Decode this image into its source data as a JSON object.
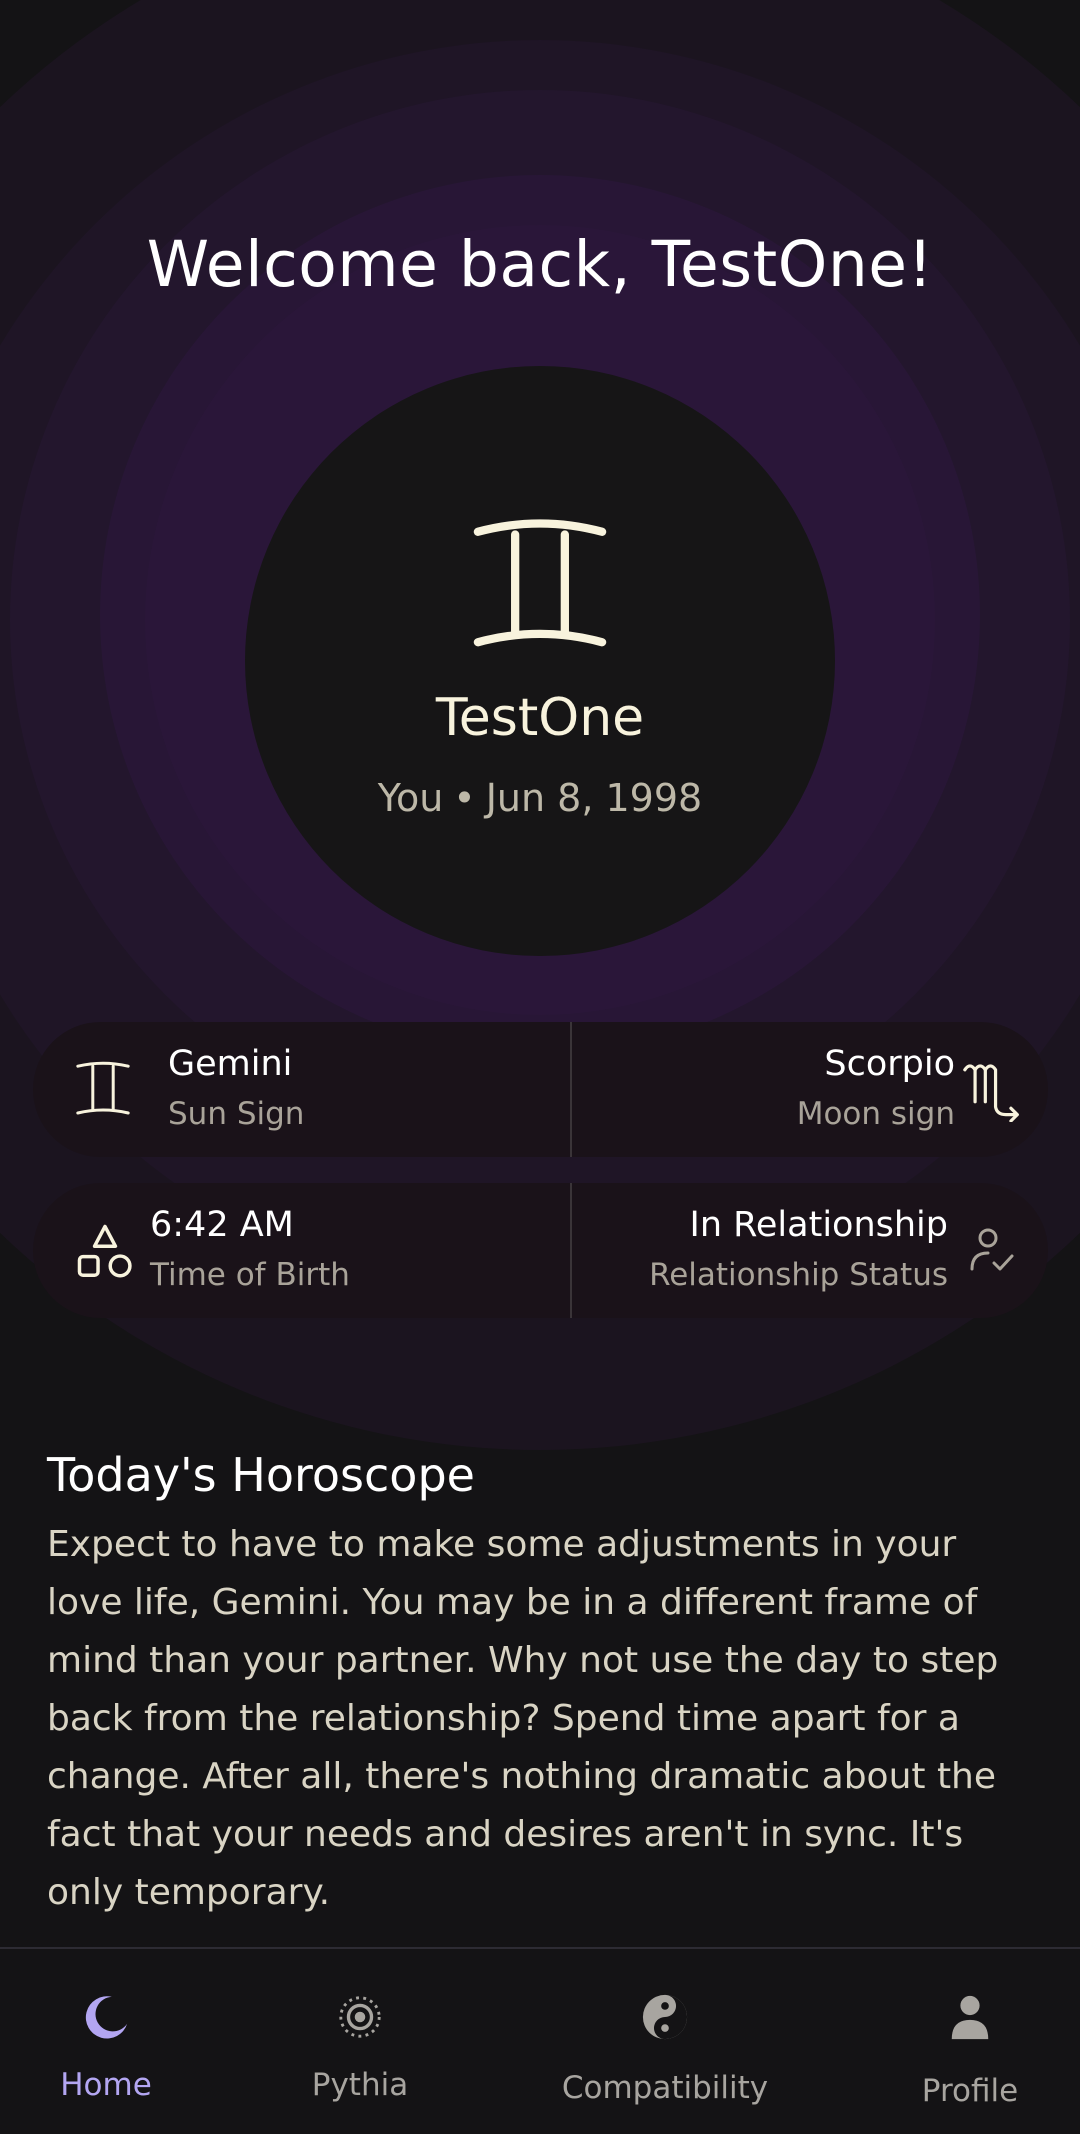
{
  "header": {
    "welcome": "Welcome back, TestOne!"
  },
  "profile": {
    "sign_icon": "gemini-icon",
    "name": "TestOne",
    "relation": "You",
    "separator": "•",
    "birth_date": "Jun 8, 1998"
  },
  "cards": {
    "sun": {
      "title": "Gemini",
      "subtitle": "Sun Sign",
      "icon": "gemini-icon"
    },
    "moon": {
      "title": "Scorpio",
      "subtitle": "Moon sign",
      "icon": "scorpio-icon"
    },
    "birth_time": {
      "title": "6:42 AM",
      "subtitle": "Time of Birth",
      "icon": "shapes-icon"
    },
    "relationship": {
      "title": "In Relationship",
      "subtitle": "Relationship Status",
      "icon": "person-check-icon"
    }
  },
  "horoscope": {
    "title": "Today's Horoscope",
    "text": "Expect to have to make some adjustments in your love life, Gemini. You may be in a different frame of mind than your partner. Why not use the day to step back from the relationship? Spend time apart for a change. After all, there's nothing dramatic about the fact that your needs and desires aren't in sync. It's only temporary."
  },
  "nav": {
    "items": [
      {
        "label": "Home",
        "icon": "moon-icon",
        "active": true
      },
      {
        "label": "Pythia",
        "icon": "eye-icon",
        "active": false
      },
      {
        "label": "Compatibility",
        "icon": "yin-yang-icon",
        "active": false
      },
      {
        "label": "Profile",
        "icon": "person-icon",
        "active": false
      }
    ]
  },
  "colors": {
    "background": "#141315",
    "glow_purple": "#2a1639",
    "accent": "#b3a6f2",
    "cream": "#f4efdc",
    "card": "#1a1219"
  }
}
